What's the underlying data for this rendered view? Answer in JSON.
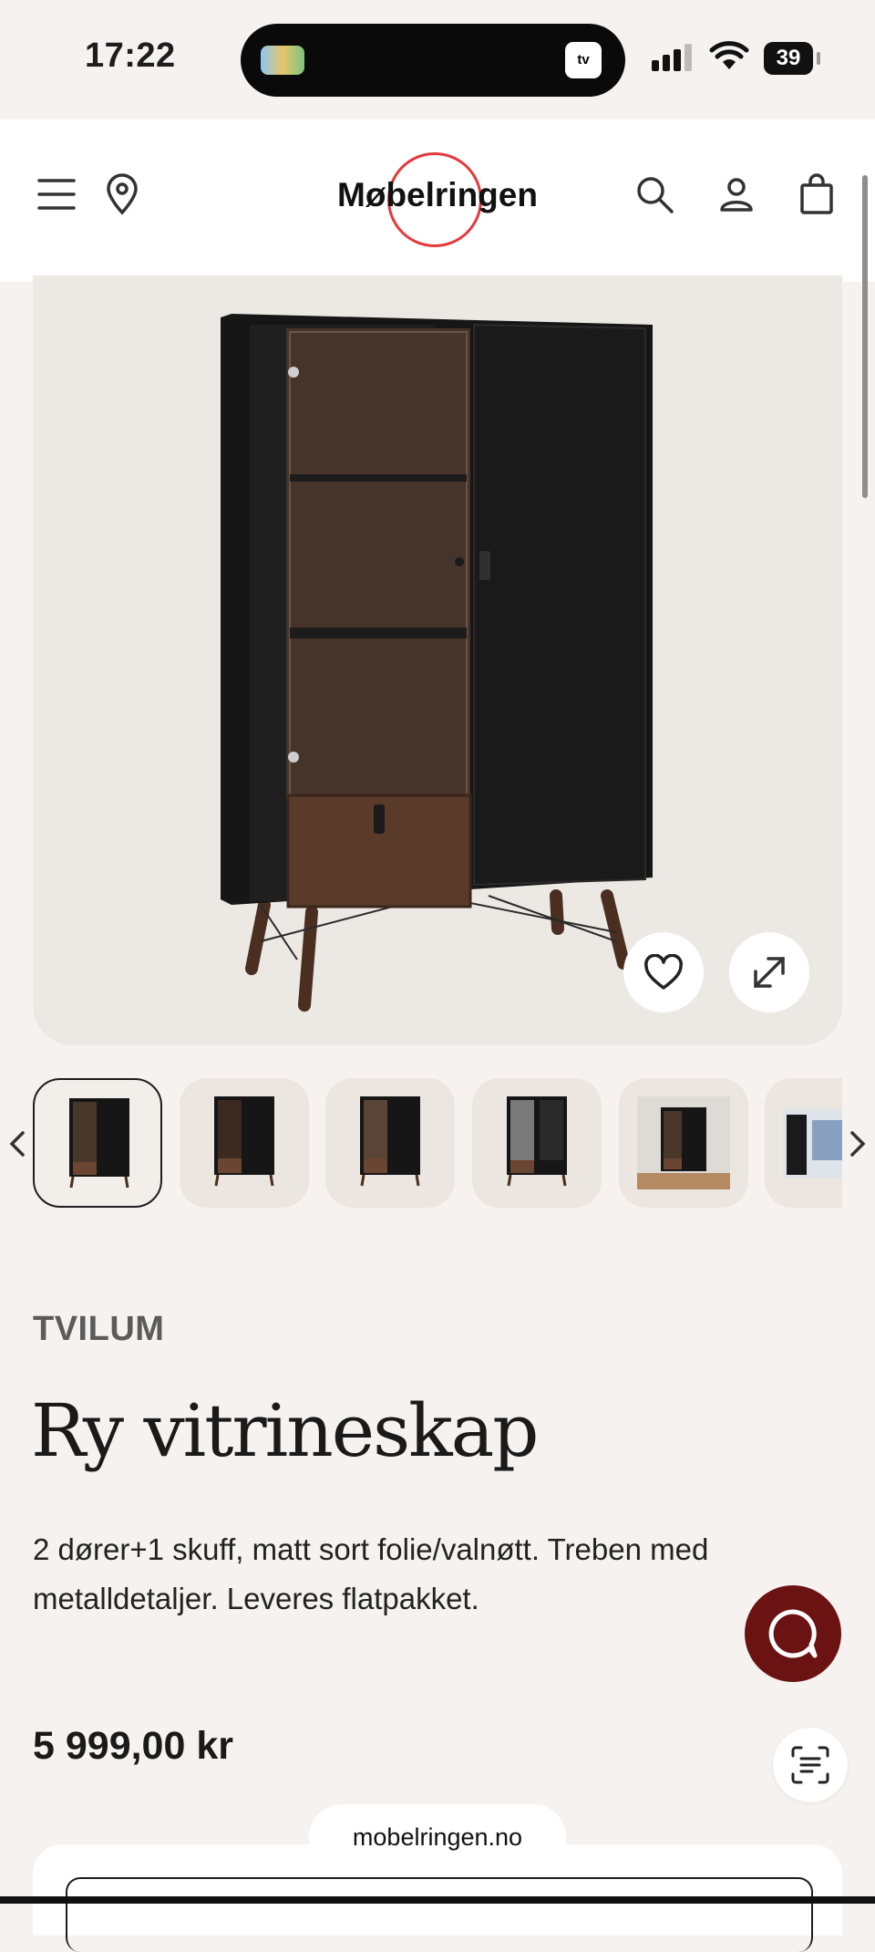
{
  "status_bar": {
    "time": "17:22",
    "battery": "39",
    "island_app": "tv"
  },
  "header": {
    "logo_text": "Møbelringen"
  },
  "icons": {
    "menu": "menu-icon",
    "location": "location-pin-icon",
    "search": "search-icon",
    "account": "user-icon",
    "cart": "shopping-bag-icon",
    "favorite": "heart-icon",
    "expand": "expand-icon",
    "chat": "chat-icon",
    "scan": "text-scan-icon",
    "prev": "chevron-left-icon",
    "next": "chevron-right-icon"
  },
  "product": {
    "brand": "TVILUM",
    "title": "Ry vitrineskap",
    "description": "2 dører+1 skuff, matt sort folie/valnøtt. Treben med metalldetaljer. Leveres flatpakket.",
    "price": "5 999,00 kr"
  },
  "gallery": {
    "thumbnail_count": 6,
    "active_index": 0
  },
  "browser": {
    "url": "mobelringen.no"
  },
  "colors": {
    "accent_red": "#e4393f",
    "chat_bg": "#6b1313",
    "page_bg": "#f6f2ef"
  }
}
